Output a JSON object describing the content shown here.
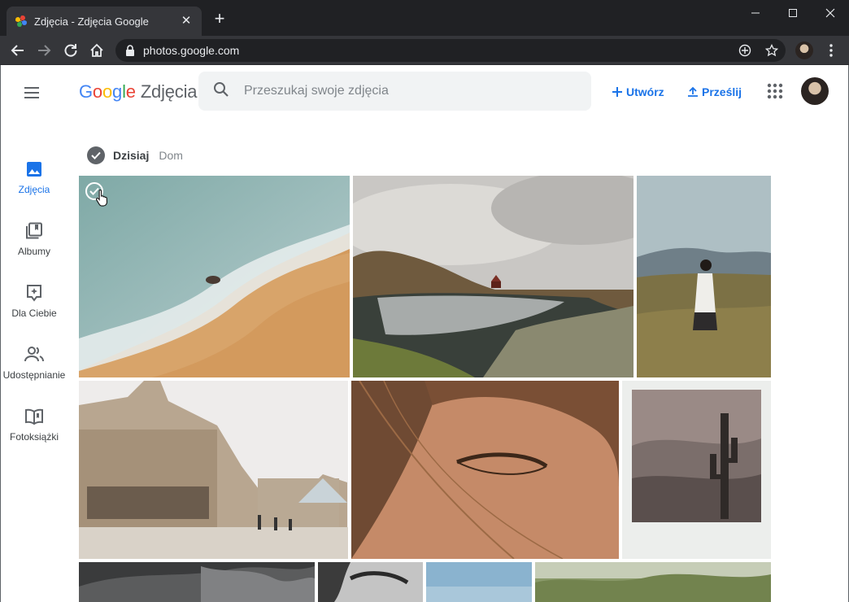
{
  "browser": {
    "tab_title": "Zdjęcia - Zdjęcia Google",
    "url": "photos.google.com"
  },
  "header": {
    "logo_letters": [
      "G",
      "o",
      "o",
      "g",
      "l",
      "e"
    ],
    "logo_colors": [
      "#4285f4",
      "#ea4335",
      "#fbbc05",
      "#4285f4",
      "#34a853",
      "#ea4335"
    ],
    "product": "Zdjęcia",
    "search_placeholder": "Przeszukaj swoje zdjęcia",
    "create_label": "Utwórz",
    "upload_label": "Prześlij"
  },
  "sidebar": {
    "items": [
      {
        "label": "Zdjęcia",
        "icon": "photo-icon",
        "active": true
      },
      {
        "label": "Albumy",
        "icon": "album-icon",
        "active": false
      },
      {
        "label": "Dla Ciebie",
        "icon": "for-you-icon",
        "active": false
      },
      {
        "label": "Udostępnianie",
        "icon": "sharing-icon",
        "active": false
      },
      {
        "label": "Fotoksiążki",
        "icon": "photobook-icon",
        "active": false
      }
    ]
  },
  "section": {
    "date": "Dzisiaj",
    "location": "Dom"
  },
  "colors": {
    "accent": "#1a73e8",
    "chrome_dark": "#202124",
    "chrome_toolbar": "#35363a"
  }
}
